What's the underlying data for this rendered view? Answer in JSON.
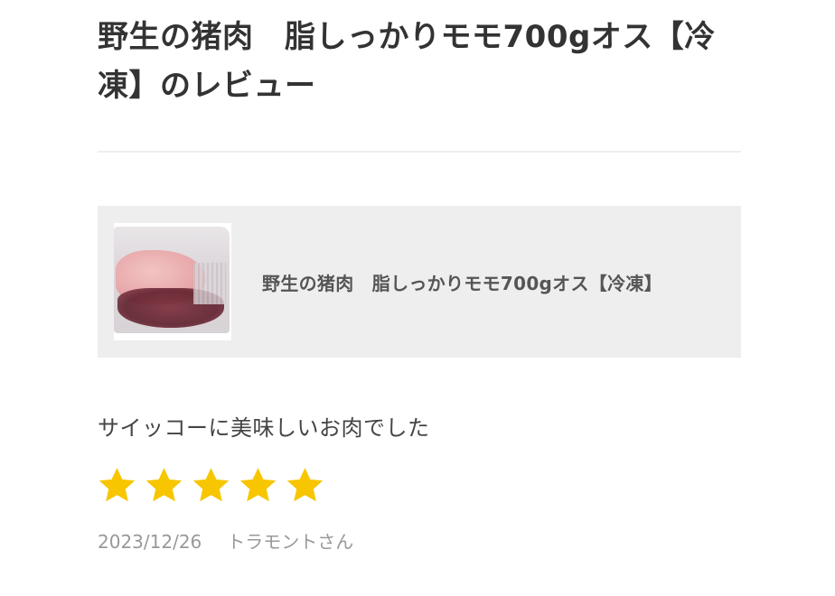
{
  "page": {
    "title": "野生の猪肉　脂しっかりモモ700gオス【冷凍】のレビュー"
  },
  "product": {
    "name": "野生の猪肉　脂しっかりモモ700gオス【冷凍】",
    "thumbnail": "frozen-boar-meat-thumbnail"
  },
  "review": {
    "text": "サイッコーに美味しいお肉でした",
    "rating": 5,
    "rating_max": 5,
    "date": "2023/12/26",
    "author": "トラモントさん"
  },
  "colors": {
    "star": "#f7c600",
    "card_bg": "#eeeeee",
    "divider": "#efefef",
    "meta_text": "#999999"
  }
}
